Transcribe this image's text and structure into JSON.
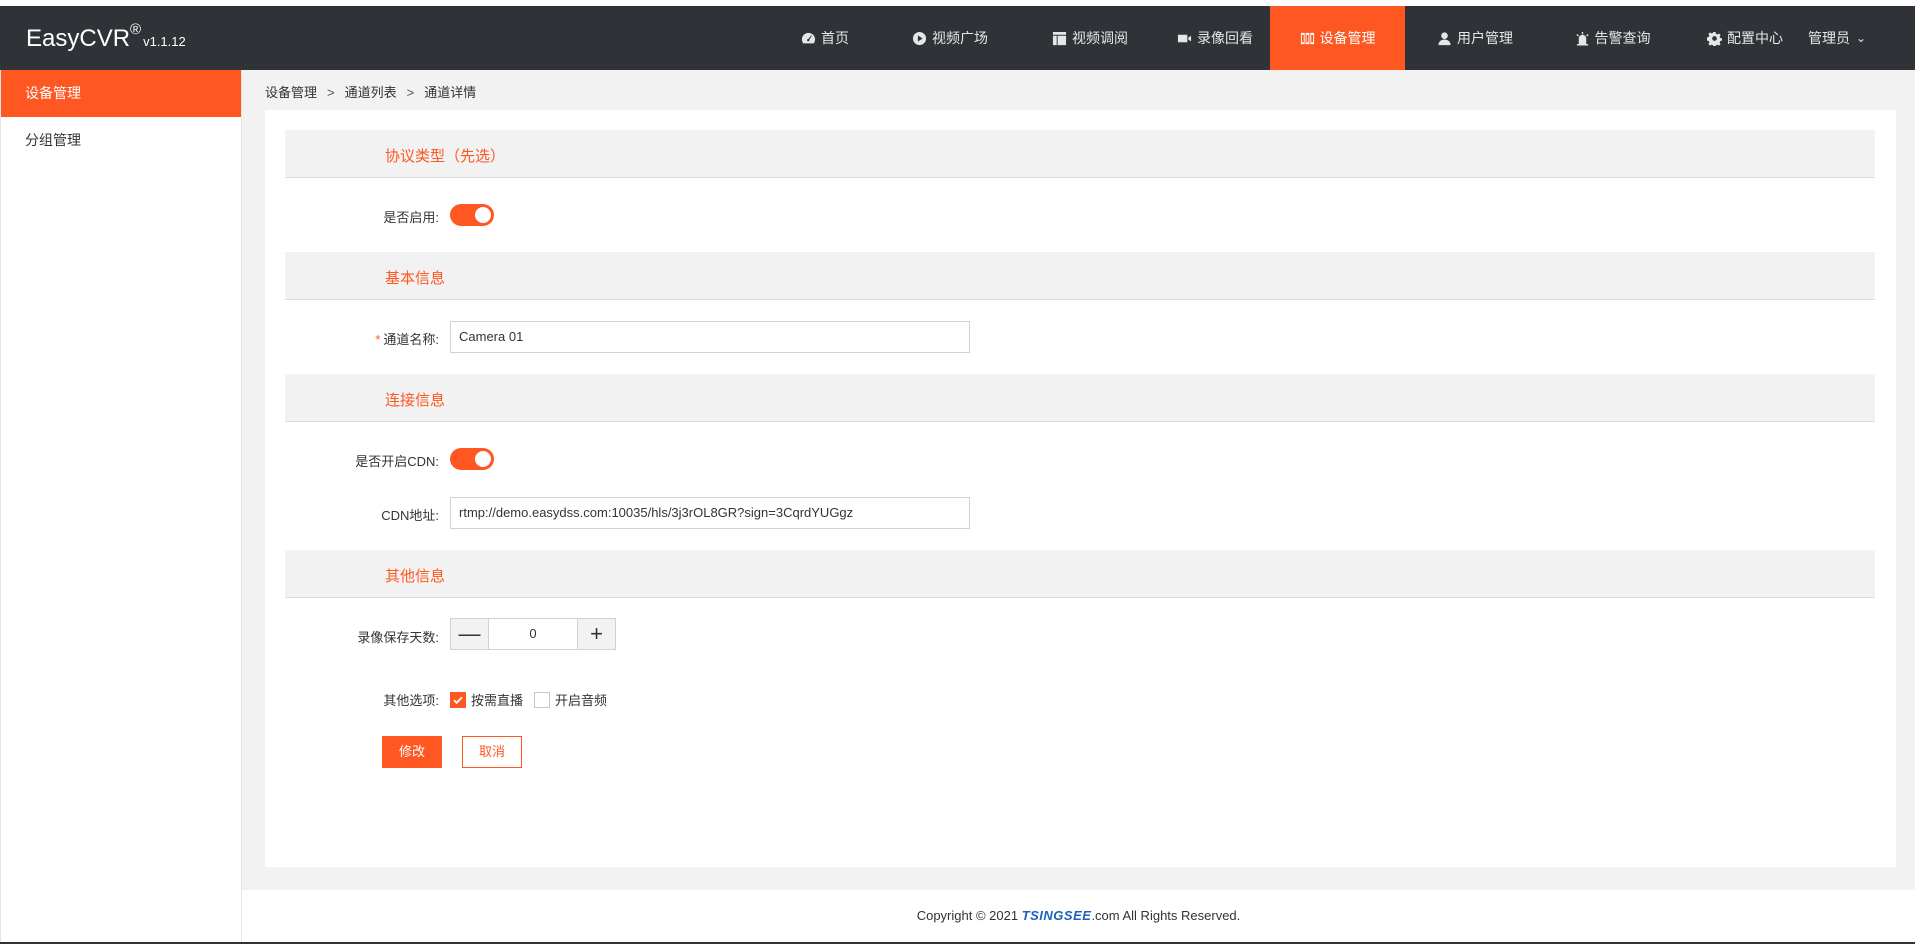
{
  "header": {
    "logo": "EasyCVR",
    "logo_mark": "®",
    "version": "v1.1.12",
    "nav": [
      {
        "label": "首页",
        "icon": "dashboard-icon"
      },
      {
        "label": "视频广场",
        "icon": "play-icon"
      },
      {
        "label": "视频调阅",
        "icon": "layout-icon"
      },
      {
        "label": "录像回看",
        "icon": "video-camera-icon"
      },
      {
        "label": "设备管理",
        "icon": "device-icon",
        "active": true
      },
      {
        "label": "用户管理",
        "icon": "user-icon"
      },
      {
        "label": "告警查询",
        "icon": "alarm-icon"
      },
      {
        "label": "配置中心",
        "icon": "gear-icon"
      }
    ],
    "user": "管理员"
  },
  "sidebar": {
    "items": [
      {
        "label": "设备管理",
        "active": true
      },
      {
        "label": "分组管理",
        "active": false
      }
    ]
  },
  "breadcrumb": [
    "设备管理",
    "通道列表",
    "通道详情"
  ],
  "breadcrumb_sep": ">",
  "form": {
    "sections": {
      "protocol": "协议类型（先选）",
      "basic": "基本信息",
      "connection": "连接信息",
      "other": "其他信息"
    },
    "enabled_label": "是否启用:",
    "enabled": true,
    "required_mark": "*",
    "channel_name_label": "通道名称:",
    "channel_name": "Camera 01",
    "cdn_enabled_label": "是否开启CDN:",
    "cdn_enabled": true,
    "cdn_url_label": "CDN地址:",
    "cdn_url": "rtmp://demo.easydss.com:10035/hls/3j3rOL8GR?sign=3CqrdYUGgz",
    "record_days_label": "录像保存天数:",
    "record_days": "0",
    "minus": "—",
    "plus": "+",
    "other_options_label": "其他选项:",
    "options": [
      {
        "label": "按需直播",
        "checked": true
      },
      {
        "label": "开启音频",
        "checked": false
      }
    ],
    "submit": "修改",
    "cancel": "取消"
  },
  "footer": {
    "prefix": "Copyright © 2021",
    "brand": "TSINGSEE",
    "suffix": ".com All Rights Reserved."
  },
  "colors": {
    "accent": "#ff5722",
    "header_bg": "#2f3338",
    "content_bg": "#f2f2f2"
  }
}
